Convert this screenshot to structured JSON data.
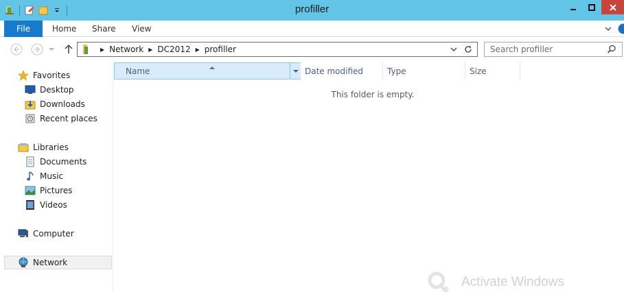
{
  "window": {
    "title": "profiller"
  },
  "ribbon": {
    "file_label": "File",
    "tabs": [
      {
        "label": "Home"
      },
      {
        "label": "Share"
      },
      {
        "label": "View"
      }
    ]
  },
  "address": {
    "crumbs": [
      "Network",
      "DC2012",
      "profiller"
    ]
  },
  "search": {
    "placeholder": "Search profiller"
  },
  "nav": {
    "favorites": {
      "label": "Favorites",
      "items": [
        {
          "label": "Desktop",
          "icon": "desktop-icon"
        },
        {
          "label": "Downloads",
          "icon": "downloads-icon"
        },
        {
          "label": "Recent places",
          "icon": "recent-places-icon"
        }
      ]
    },
    "libraries": {
      "label": "Libraries",
      "items": [
        {
          "label": "Documents",
          "icon": "documents-icon"
        },
        {
          "label": "Music",
          "icon": "music-icon"
        },
        {
          "label": "Pictures",
          "icon": "pictures-icon"
        },
        {
          "label": "Videos",
          "icon": "videos-icon"
        }
      ]
    },
    "computer": {
      "label": "Computer"
    },
    "network": {
      "label": "Network",
      "selected": true
    }
  },
  "columns": [
    {
      "label": "Name",
      "sorted": "ascending"
    },
    {
      "label": "Date modified"
    },
    {
      "label": "Type"
    },
    {
      "label": "Size"
    }
  ],
  "content": {
    "empty_message": "This folder is empty."
  },
  "watermark": {
    "text": "Activate Windows"
  },
  "colors": {
    "titlebar": "#62c4e6",
    "file_tab": "#1979ca",
    "close_button": "#c7453b",
    "selected_column": "#d9ebf9"
  }
}
